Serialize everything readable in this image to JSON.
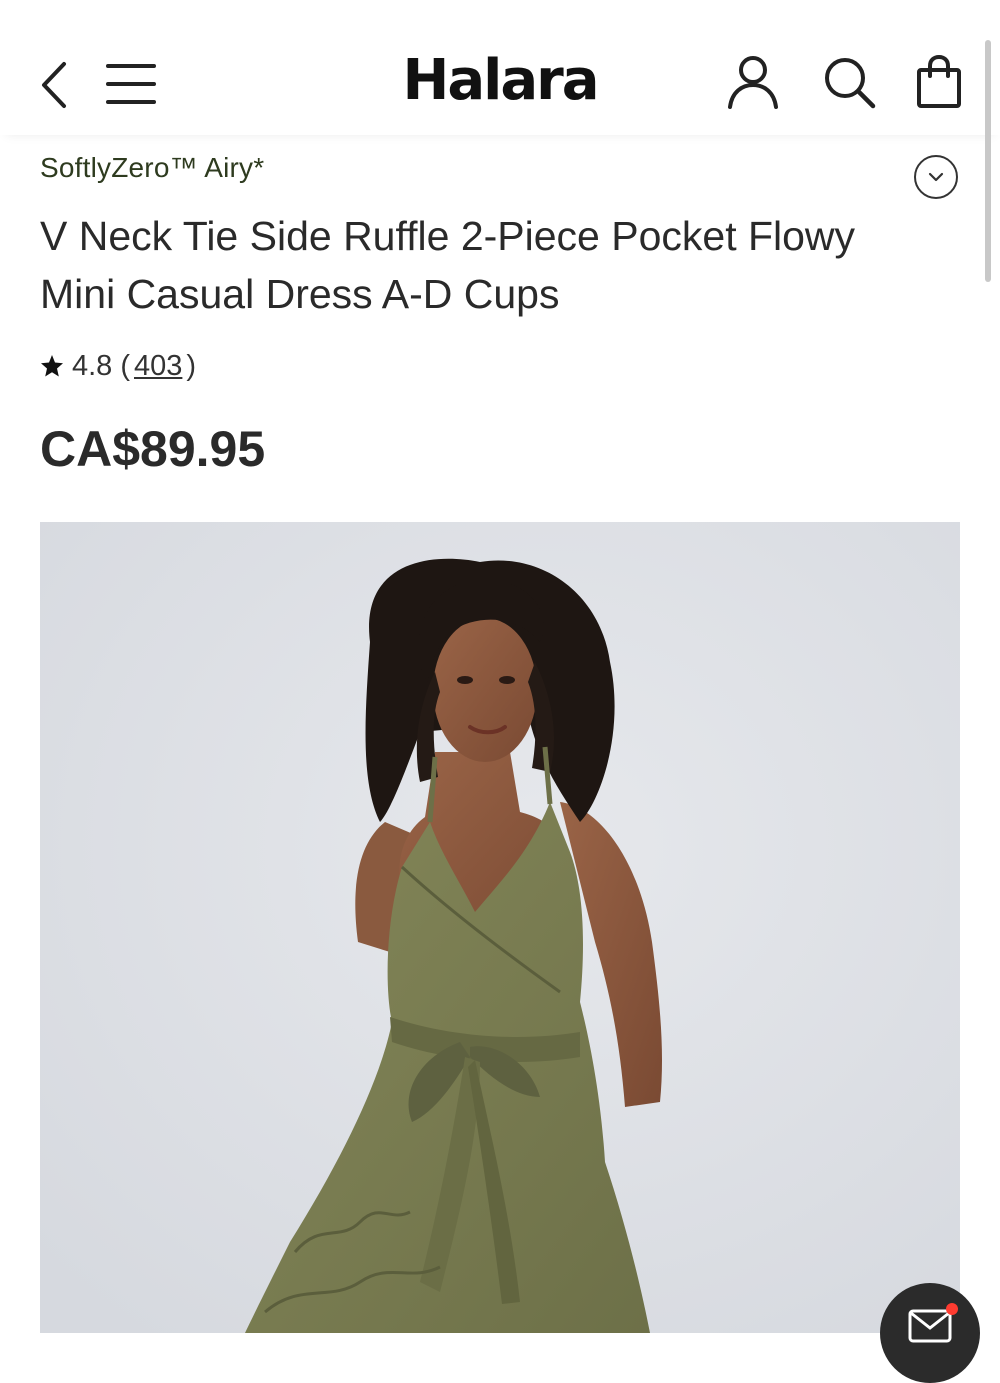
{
  "header": {
    "brand": "Halara",
    "icons": [
      "back-icon",
      "menu-icon",
      "account-icon",
      "search-icon",
      "bag-icon"
    ]
  },
  "product": {
    "collection": "SoftlyZero™ Airy*",
    "title": "V Neck Tie Side Ruffle 2-Piece Pocket Flowy Mini Casual Dress A-D Cups",
    "rating": {
      "score": "4.8",
      "open": "(",
      "count": "403",
      "close": ")"
    },
    "price": "CA$89.95"
  },
  "image": {
    "alt": "Model wearing olive green V neck ruffle mini dress"
  },
  "colors": {
    "collection_text": "#2e3b1f",
    "dress_olive": "#7a7d52",
    "image_background": "#dee0e5",
    "chat_button": "#2b2b2b",
    "notification_dot": "#ff3b30"
  }
}
